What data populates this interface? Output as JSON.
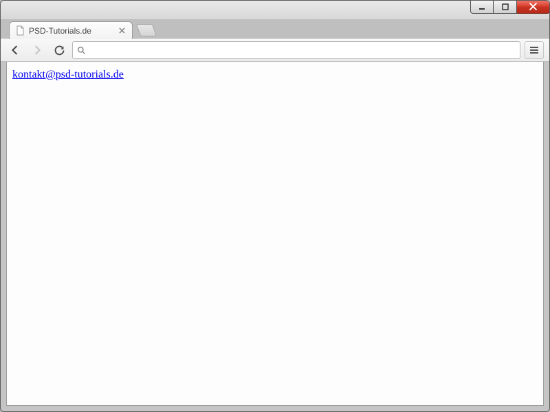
{
  "window": {
    "controls": {
      "minimize": "minimize",
      "maximize": "maximize",
      "close": "close"
    }
  },
  "tabs": {
    "active": {
      "title": "PSD-Tutorials.de",
      "favicon": "file-icon"
    }
  },
  "toolbar": {
    "back": "back",
    "forward": "forward",
    "reload": "reload",
    "menu": "menu",
    "omnibox": {
      "value": "",
      "placeholder": ""
    }
  },
  "page": {
    "link_text": "kontakt@psd-tutorials.de"
  }
}
